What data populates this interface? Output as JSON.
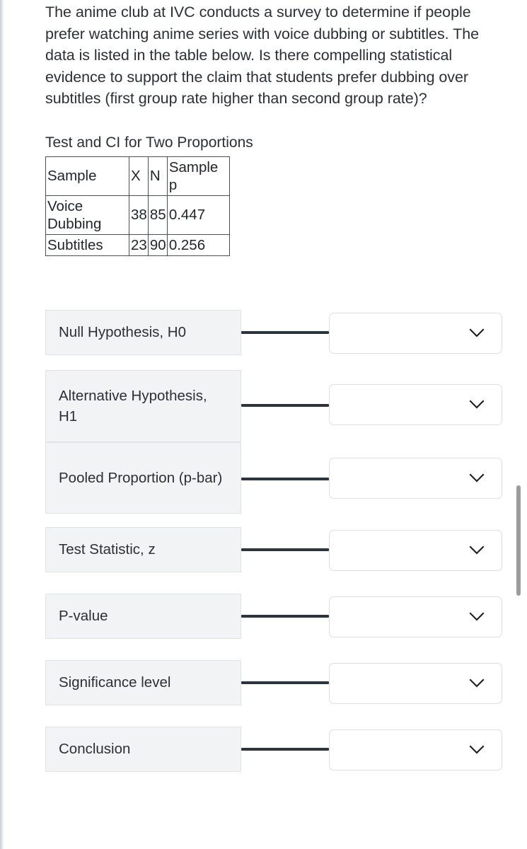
{
  "question": {
    "text": "The anime club at IVC conducts a survey to determine if people prefer watching anime series with voice dubbing or subtitles. The data is listed in the table below. Is there compelling statistical evidence to support the claim that students prefer dubbing over subtitles (first group rate higher than second group rate)?"
  },
  "output": {
    "heading": "Test and CI for Two Proportions",
    "table": {
      "headers": [
        "Sample",
        "X",
        "N",
        "Sample\np"
      ],
      "rows": [
        {
          "sample": "Voice\nDubbing",
          "x": "38",
          "n": "85",
          "sample_p": "0.447"
        },
        {
          "sample": "Subtitles",
          "x": "23",
          "n": "90",
          "sample_p": "0.256"
        }
      ]
    }
  },
  "form": {
    "rows": [
      {
        "label": "Null Hypothesis, H0",
        "value": "",
        "icon": "chevron-down-icon"
      },
      {
        "label": "Alternative Hypothesis, H1",
        "value": "",
        "icon": "chevron-down-icon"
      },
      {
        "label": "Pooled Proportion (p-bar)",
        "value": "",
        "icon": "chevron-down-icon"
      },
      {
        "label": "Test Statistic, z",
        "value": "",
        "icon": "chevron-down-icon"
      },
      {
        "label": "P-value",
        "value": "",
        "icon": "chevron-down-icon"
      },
      {
        "label": "Significance level",
        "value": "",
        "icon": "chevron-down-icon"
      },
      {
        "label": "Conclusion",
        "value": "",
        "icon": "chevron-down-icon"
      }
    ]
  },
  "scrollbar": {
    "orientation": "vertical"
  },
  "colors": {
    "text": "#2b3036",
    "label_background": "#f2f3f4",
    "label_border": "#e0e2e5",
    "connector": "#2c3440",
    "dropdown_border": "#dcdee1",
    "table_border": "#4a4f57",
    "scrollbar_thumb": "#9c9c9c"
  }
}
